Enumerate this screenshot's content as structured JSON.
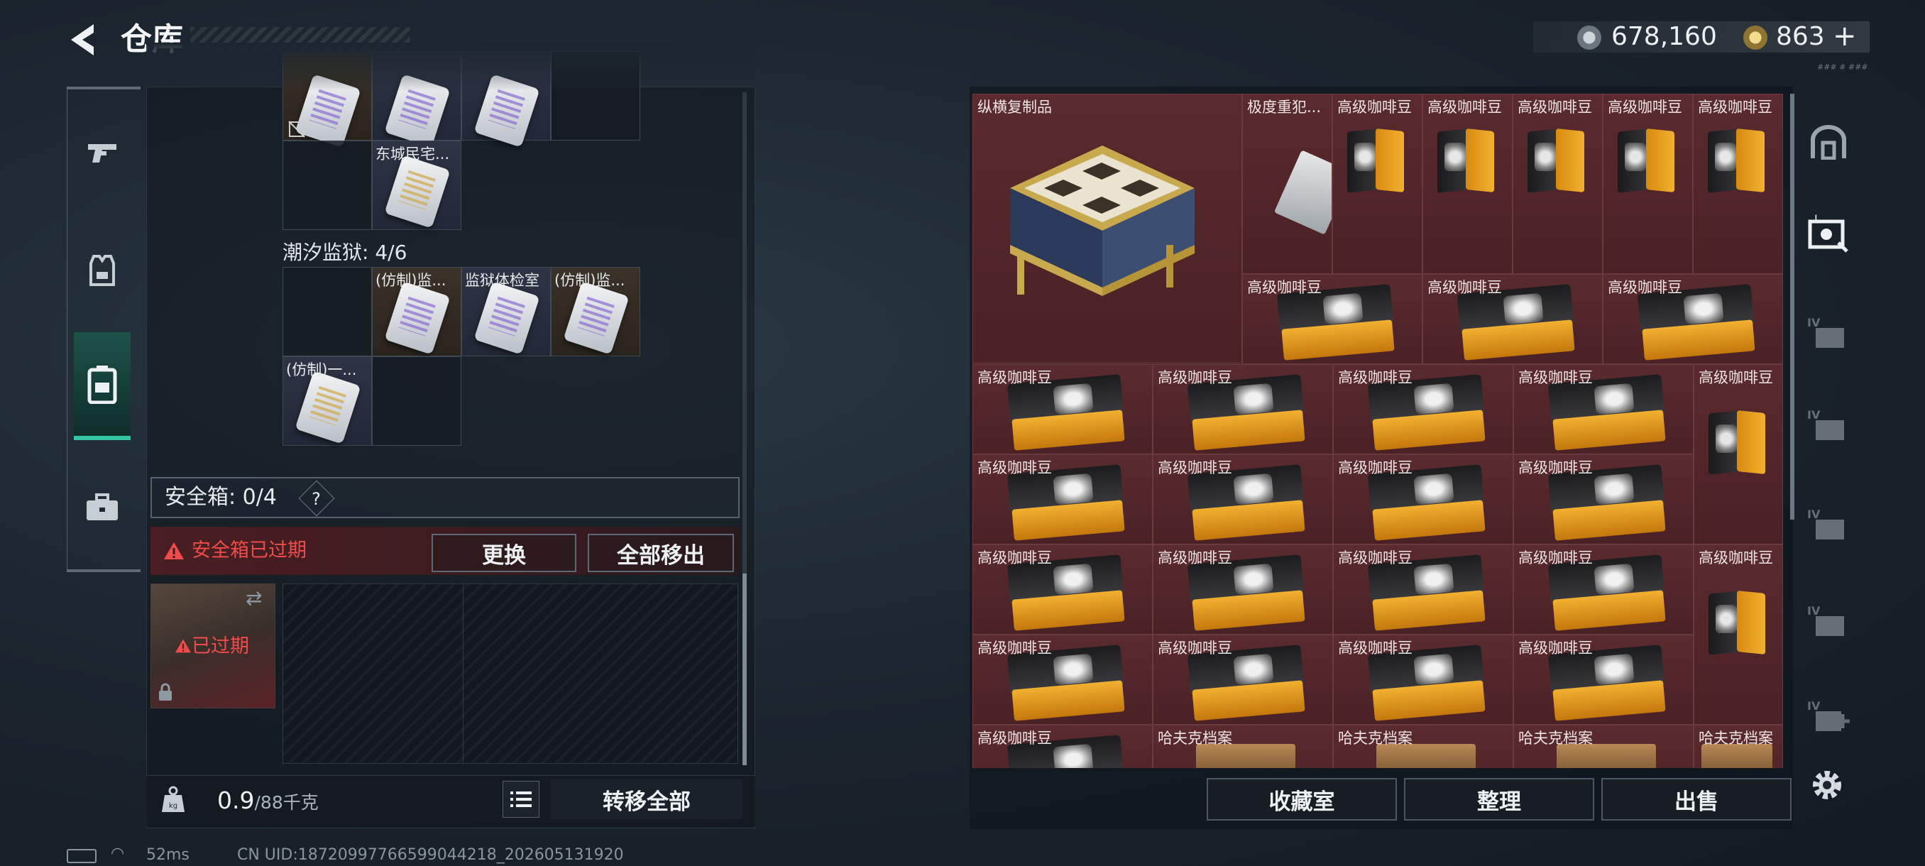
{
  "header": {
    "title": "仓库",
    "currency_silver": "678,160",
    "currency_gold": "863",
    "currency_gold_add": "+",
    "version_text": "### # ###"
  },
  "left_tabs": [
    "armory",
    "gear",
    "backpack",
    "kit"
  ],
  "stash_grid": {
    "row1_labels": [
      "",
      "",
      "",
      ""
    ],
    "row2_label": "东城民宅...",
    "section_label": "潮汐监狱: 4/6",
    "row3_labels": [
      "",
      "(仿制)监...",
      "监狱体检室",
      "(仿制)监..."
    ],
    "row4_label": "(仿制)一..."
  },
  "safebox": {
    "label": "安全箱: 0/4",
    "help": "?",
    "expired_msg": "安全箱已过期",
    "replace": "更换",
    "move_all": "全部移出",
    "slot_status": "已过期"
  },
  "left_footer": {
    "weight_value": "0.9",
    "weight_max": "/88千克",
    "transfer_all": "转移全部"
  },
  "status": {
    "ping": "52ms",
    "uid": "CN UID:18720997766599044218_202605131920"
  },
  "right_grid": {
    "chess_label": "纵横复制品",
    "pager_label": "极度重犯...",
    "coffee_label": "高级咖啡豆",
    "archive_label": "哈夫克档案"
  },
  "right_footer": {
    "collection": "收藏室",
    "sort": "整理",
    "sell": "出售"
  }
}
